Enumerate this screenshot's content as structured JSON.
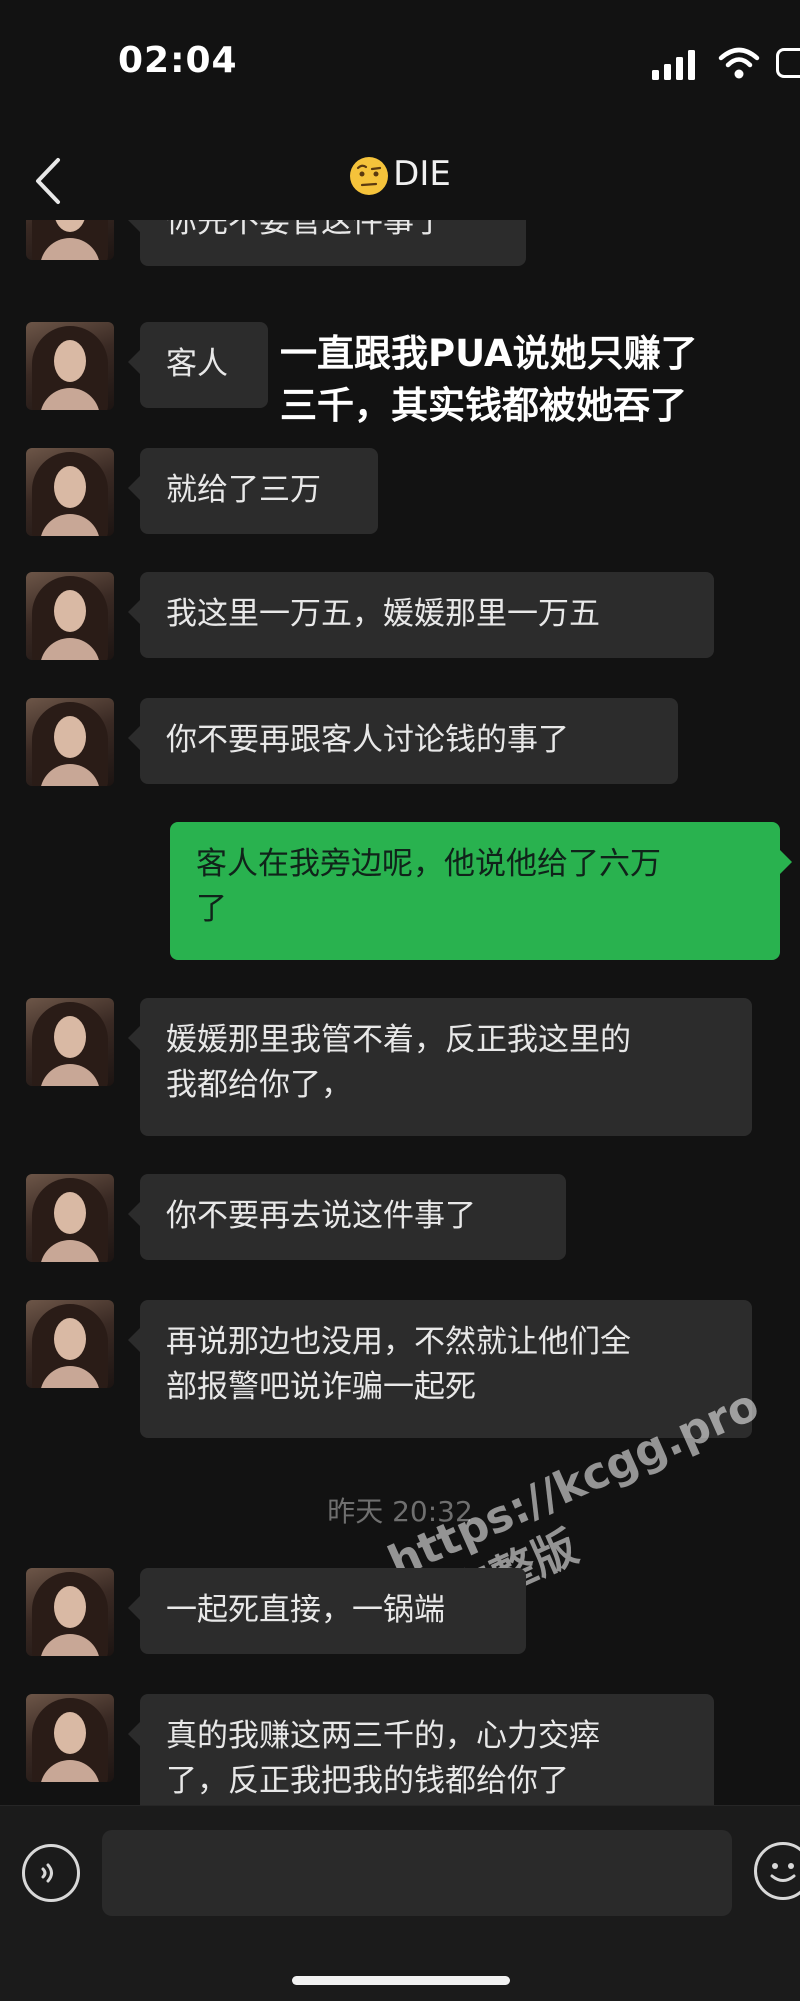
{
  "status_bar": {
    "time": "02:04"
  },
  "header": {
    "title": "DIE",
    "title_emoji_icon": "raised-eyebrow-emoji-icon",
    "back_icon": "chevron-left-icon"
  },
  "overlay_caption": "一直跟我PUA说她只赚了\n三千，其实钱都被她吞了",
  "messages": [
    {
      "side": "left",
      "text": "你先不要管这件事了"
    },
    {
      "side": "left",
      "text": "客人"
    },
    {
      "side": "left",
      "text": "就给了三万"
    },
    {
      "side": "left",
      "text": "我这里一万五，媛媛那里一万五"
    },
    {
      "side": "left",
      "text": "你不要再跟客人讨论钱的事了"
    },
    {
      "side": "right",
      "text": "客人在我旁边呢，他说他给了六万\n了"
    },
    {
      "side": "left",
      "text": "媛媛那里我管不着，反正我这里的\n我都给你了，"
    },
    {
      "side": "left",
      "text": "你不要再去说这件事了"
    },
    {
      "side": "left",
      "text": "再说那边也没用，不然就让他们全\n部报警吧说诈骗一起死"
    },
    {
      "side": "left",
      "text": "一起死直接，一锅端"
    },
    {
      "side": "left",
      "text": "真的我赚这两三千的，心力交瘁\n了，反正我把我的钱都给你了"
    }
  ],
  "timestamp": "昨天 20:32",
  "watermark": "https://kcgg.pro\n看完整版",
  "input_bar": {
    "voice_icon": "voice-icon",
    "emoji_icon": "smiley-icon"
  },
  "colors": {
    "background": "#121212",
    "bubble_left": "#2c2c2c",
    "bubble_right": "#29b24f"
  }
}
